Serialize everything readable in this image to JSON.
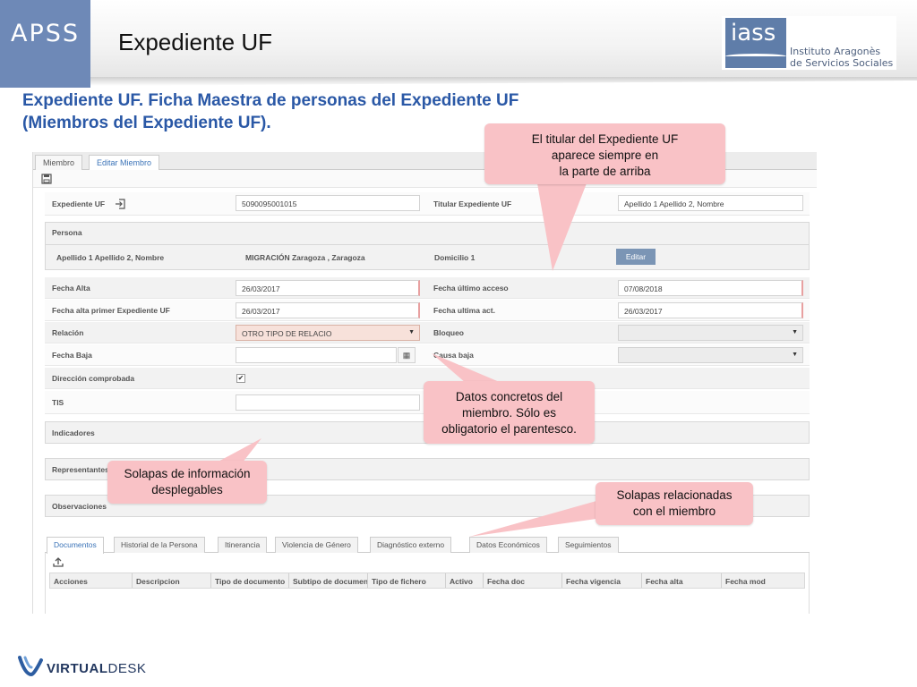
{
  "header": {
    "brand": "APSS",
    "title": "Expediente UF",
    "logo_mark": "iass",
    "logo_line1": "Instituto Aragonès",
    "logo_line2": "de Servicios Sociales"
  },
  "subtitle": {
    "line1": "Expediente UF. Ficha Maestra de personas del Expediente UF",
    "line2": "(Miembros del Expediente UF)."
  },
  "app": {
    "tabs": [
      "Miembro",
      "Editar Miembro"
    ],
    "active_tab": "Editar Miembro",
    "toolbar_icon": "save-icon",
    "expediente": {
      "label": "Expediente UF",
      "value": "5090095001015",
      "titular_label": "Titular Expediente UF",
      "titular_value": "Apellido 1 Apellido 2, Nombre"
    },
    "persona": {
      "section_label": "Persona",
      "nombre": "Apellido 1 Apellido 2, Nombre",
      "lugar": "MIGRACIÓN Zaragoza , Zaragoza",
      "domicilio": "Domicilio 1",
      "edit_button": "Editar"
    },
    "fields": {
      "fecha_alta_label": "Fecha Alta",
      "fecha_alta_value": "26/03/2017",
      "fecha_ultimo_acceso_label": "Fecha último acceso",
      "fecha_ultimo_acceso_value": "07/08/2018",
      "fecha_alta_primer_label": "Fecha alta primer Expediente UF",
      "fecha_alta_primer_value": "26/03/2017",
      "fecha_ultima_act_label": "Fecha ultima act.",
      "fecha_ultima_act_value": "26/03/2017",
      "relacion_label": "Relación",
      "relacion_value": "OTRO TIPO DE RELACIO",
      "bloqueo_label": "Bloqueo",
      "bloqueo_value": "",
      "fecha_baja_label": "Fecha Baja",
      "fecha_baja_value": "",
      "causa_baja_label": "Causa baja",
      "causa_baja_value": "",
      "direccion_label": "Dirección comprobada",
      "direccion_checked": "✔",
      "tis_label": "TIS",
      "tis_value": ""
    },
    "sections": [
      "Indicadores",
      "Representantes",
      "Observaciones"
    ],
    "bottom_tabs": [
      "Documentos",
      "Historial de la Persona",
      "Itinerancia",
      "Violencia de Género",
      "Diagnóstico externo",
      "Datos Económicos",
      "Seguimientos"
    ],
    "active_bottom_tab": "Documentos",
    "upload_icon": "upload-icon",
    "grid_columns": [
      "Acciones",
      "Descripcion",
      "Tipo de documento",
      "Subtipo de documento",
      "Tipo de fichero",
      "Activo",
      "Fecha doc",
      "Fecha vigencia",
      "Fecha alta",
      "Fecha mod"
    ]
  },
  "callouts": {
    "titular": [
      "El titular del Expediente UF",
      "aparece siempre en",
      "la parte de arriba"
    ],
    "datos": [
      "Datos concretos del",
      "miembro. Sólo es",
      "obligatorio el parentesco."
    ],
    "solapas_info": [
      "Solapas de información",
      "desplegables"
    ],
    "solapas_rel": [
      "Solapas relacionadas",
      "con el miembro"
    ],
    "color": "#f9c2c6"
  },
  "footer": {
    "logo_bold": "VIRTUAL",
    "logo_rest": "DESK"
  },
  "colors": {
    "brand": "#6e89b7",
    "subtitle": "#2a58a6",
    "edit_button": "#7b95b5",
    "tab_active_text": "#3c74b8"
  }
}
